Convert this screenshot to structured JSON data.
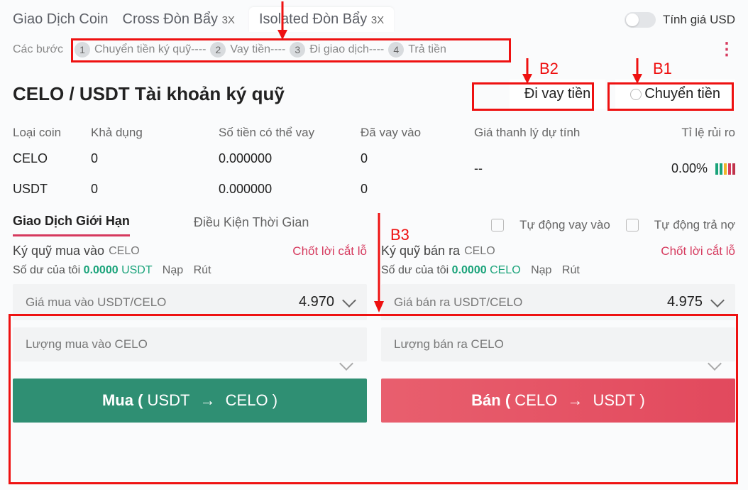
{
  "top_tabs": {
    "coin": "Giao Dịch Coin",
    "cross": "Cross Đòn Bẩy",
    "cross_lev": "3X",
    "isolated": "Isolated Đòn Bẩy",
    "isolated_lev": "3X"
  },
  "price_toggle_label": "Tính giá USD",
  "steps": {
    "prefix": "Các bước",
    "items": [
      "Chuyển tiền ký quỹ----",
      "Vay tiền----",
      "Đi giao dịch----",
      "Trả tiền"
    ]
  },
  "account": {
    "title": "CELO / USDT Tài khoản ký quỹ",
    "borrow_btn": "Đi vay tiền",
    "transfer_btn": "Chuyển tiền"
  },
  "table": {
    "headers": {
      "coin": "Loại coin",
      "available": "Khả dụng",
      "borrowable": "Số tiền có thể vay",
      "borrowed": "Đã vay vào",
      "liq_price": "Giá thanh lý dự tính",
      "risk": "Tỉ lệ rủi ro"
    },
    "rows": [
      {
        "coin": "CELO",
        "available": "0",
        "borrowable": "0.000000",
        "borrowed": "0"
      },
      {
        "coin": "USDT",
        "available": "0",
        "borrowable": "0.000000",
        "borrowed": "0"
      }
    ],
    "liq_value": "--",
    "risk_value": "0.00%"
  },
  "order_tabs": {
    "limit": "Giao Dịch Giới Hạn",
    "time": "Điều Kiện Thời Gian"
  },
  "auto": {
    "borrow": "Tự động vay vào",
    "repay": "Tự động trả nợ"
  },
  "buy": {
    "title": "Ký quỹ mua vào",
    "coin": "CELO",
    "tpsl": "Chốt lời cắt lỗ",
    "balance_label": "Số dư của tôi",
    "balance_value": "0.0000",
    "balance_coin": "USDT",
    "deposit": "Nạp",
    "withdraw": "Rút",
    "price_label": "Giá mua vào USDT/CELO",
    "price_value": "4.970",
    "amount_label": "Lượng mua vào CELO",
    "btn_main": "Mua (",
    "btn_from": "USDT",
    "btn_to": "CELO",
    "btn_close": ")"
  },
  "sell": {
    "title": "Ký quỹ bán ra",
    "coin": "CELO",
    "tpsl": "Chốt lời cắt lỗ",
    "balance_label": "Số dư của tôi",
    "balance_value": "0.0000",
    "balance_coin": "CELO",
    "deposit": "Nạp",
    "withdraw": "Rút",
    "price_label": "Giá bán ra USDT/CELO",
    "price_value": "4.975",
    "amount_label": "Lượng bán ra CELO",
    "btn_main": "Bán (",
    "btn_from": "CELO",
    "btn_to": "USDT",
    "btn_close": ")"
  },
  "annotations": {
    "b1": "B1",
    "b2": "B2",
    "b3": "B3"
  }
}
